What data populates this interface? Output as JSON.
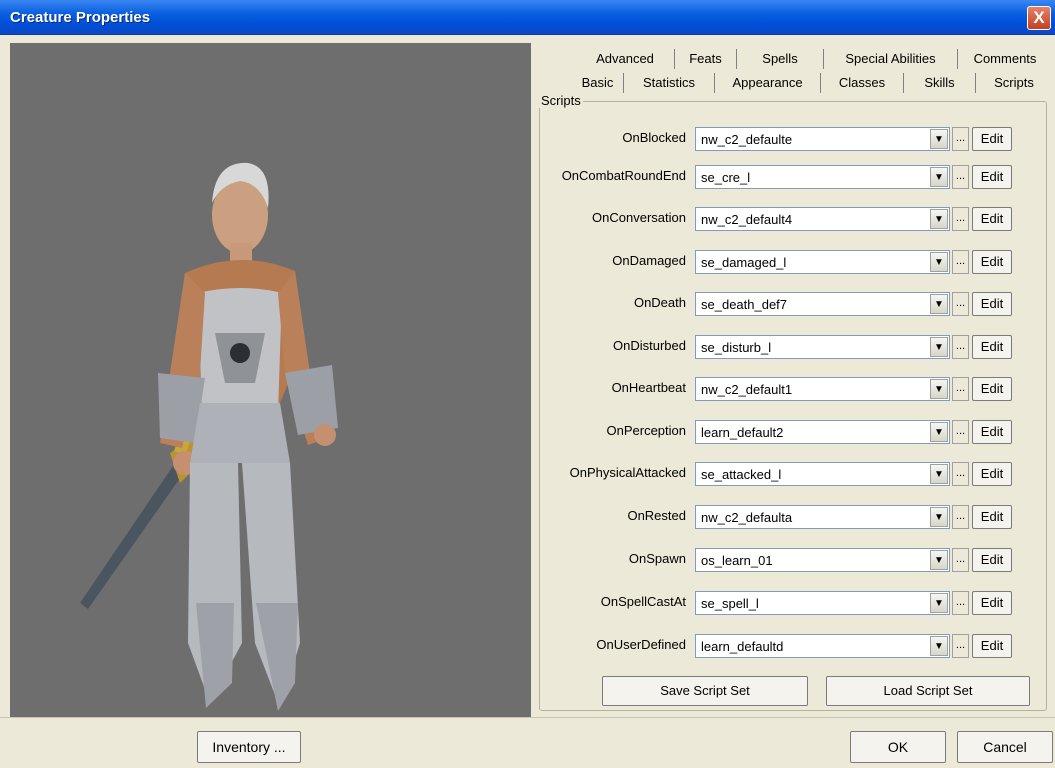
{
  "window": {
    "title": "Creature Properties",
    "close_label": "X"
  },
  "tabs_row1": [
    "Advanced",
    "Feats",
    "Spells",
    "Special Abilities",
    "Comments"
  ],
  "tabs_row2": [
    "Basic",
    "Statistics",
    "Appearance",
    "Classes",
    "Skills",
    "Scripts"
  ],
  "active_tab": "Scripts",
  "scripts_group": {
    "label": "Scripts"
  },
  "scripts": [
    {
      "event": "OnBlocked",
      "value": "nw_c2_defaulte"
    },
    {
      "event": "OnCombatRoundEnd",
      "value": "se_cre_l"
    },
    {
      "event": "OnConversation",
      "value": "nw_c2_default4"
    },
    {
      "event": "OnDamaged",
      "value": "se_damaged_l"
    },
    {
      "event": "OnDeath",
      "value": "se_death_def7"
    },
    {
      "event": "OnDisturbed",
      "value": "se_disturb_l"
    },
    {
      "event": "OnHeartbeat",
      "value": "nw_c2_default1"
    },
    {
      "event": "OnPerception",
      "value": "learn_default2"
    },
    {
      "event": "OnPhysicalAttacked",
      "value": "se_attacked_l"
    },
    {
      "event": "OnRested",
      "value": "nw_c2_defaulta"
    },
    {
      "event": "OnSpawn",
      "value": "os_learn_01"
    },
    {
      "event": "OnSpellCastAt",
      "value": "se_spell_l"
    },
    {
      "event": "OnUserDefined",
      "value": "learn_defaultd"
    }
  ],
  "row_buttons": {
    "browse": "...",
    "edit": "Edit",
    "dropdown": "▼"
  },
  "script_set": {
    "save": "Save Script Set",
    "load": "Load Script Set"
  },
  "footer": {
    "inventory": "Inventory ...",
    "ok": "OK",
    "cancel": "Cancel"
  }
}
